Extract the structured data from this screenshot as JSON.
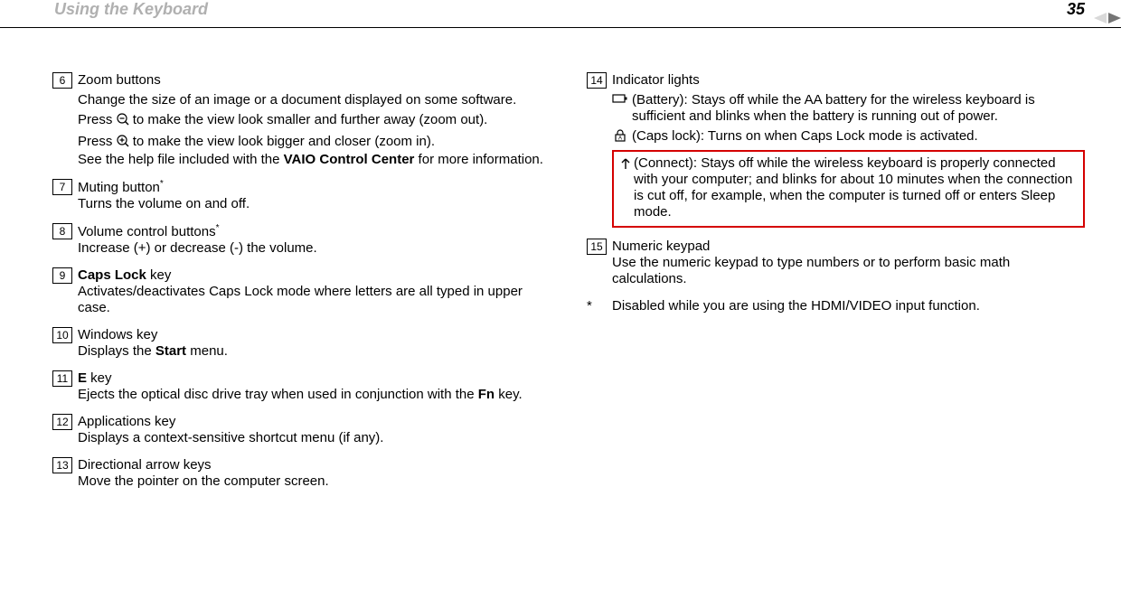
{
  "header": {
    "title": "Using the Keyboard",
    "page_number": "35"
  },
  "left": {
    "i6": {
      "num": "6",
      "title": "Zoom buttons",
      "p1": "Change the size of an image or a document displayed on some software.",
      "p2a": "Press ",
      "p2b": " to make the view look smaller and further away (zoom out).",
      "p3a": "Press ",
      "p3b": " to make the view look bigger and closer (zoom in).",
      "p4a": "See the help file included with the ",
      "p4bold": "VAIO Control Center",
      "p4b": " for more information."
    },
    "i7": {
      "num": "7",
      "title": "Muting button",
      "star": "*",
      "desc": "Turns the volume on and off."
    },
    "i8": {
      "num": "8",
      "title": "Volume control buttons",
      "star": "*",
      "desc": "Increase (+) or decrease (-) the volume."
    },
    "i9": {
      "num": "9",
      "title_bold": "Caps Lock",
      "title_rest": " key",
      "desc": "Activates/deactivates Caps Lock mode where letters are all typed in upper case."
    },
    "i10": {
      "num": "10",
      "title": "Windows key",
      "desc_a": "Displays the ",
      "desc_bold": "Start",
      "desc_b": " menu."
    },
    "i11": {
      "num": "11",
      "title_bold": "E",
      "title_rest": " key",
      "desc_a": "Ejects the optical disc drive tray when used in conjunction with the ",
      "desc_bold": "Fn",
      "desc_b": " key."
    },
    "i12": {
      "num": "12",
      "title": "Applications key",
      "desc": "Displays a context-sensitive shortcut menu (if any)."
    },
    "i13": {
      "num": "13",
      "title": "Directional arrow keys",
      "desc": "Move the pointer on the computer screen."
    }
  },
  "right": {
    "i14": {
      "num": "14",
      "title": "Indicator lights",
      "battery": " (Battery): Stays off while the AA battery for the wireless keyboard is sufficient and blinks when the battery is running out of power.",
      "caps": " (Caps lock): Turns on when Caps Lock mode is activated.",
      "connect": " (Connect): Stays off while the wireless keyboard is properly connected with your computer; and blinks for about 10 minutes when the connection is cut off, for example, when the computer is turned off or enters Sleep mode."
    },
    "i15": {
      "num": "15",
      "title": "Numeric keypad",
      "desc": "Use the numeric keypad to type numbers or to perform basic math calculations."
    },
    "footnote": {
      "star": "*",
      "text": "Disabled while you are using the HDMI/VIDEO input function."
    }
  }
}
